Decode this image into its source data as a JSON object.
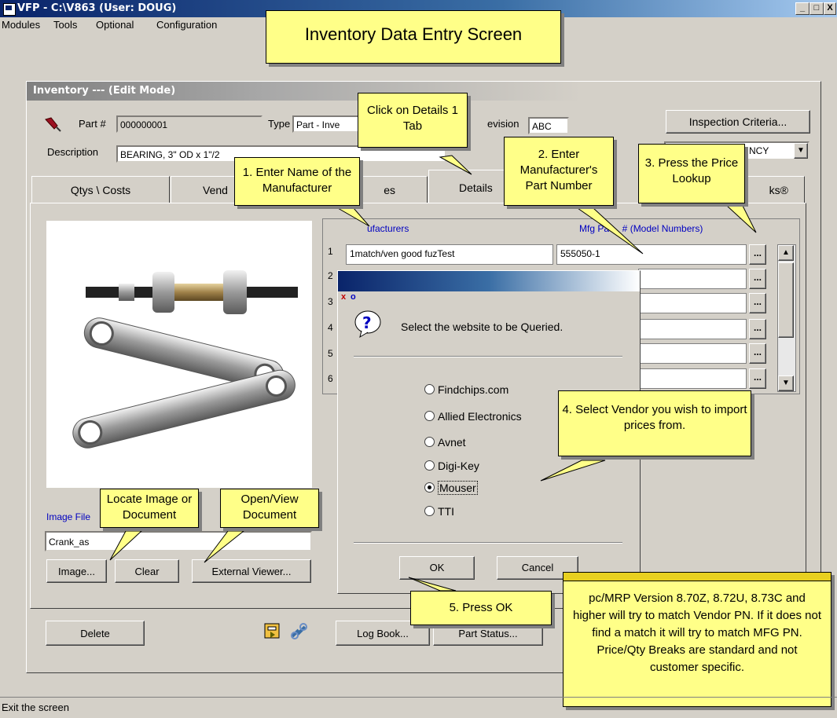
{
  "window": {
    "title": "VFP - C:\\V863  (User: DOUG)",
    "controls": [
      "_",
      "□",
      "X"
    ]
  },
  "menubar": {
    "items": [
      "Modules",
      "Tools",
      "Optional",
      "Configuration"
    ]
  },
  "inventory": {
    "title": "Inventory --- (Edit Mode)",
    "part_label": "Part #",
    "part_value": "000000001",
    "type_label": "Type",
    "type_value": "Part - Inve",
    "revision_label": "evision",
    "revision_value": "ABC",
    "inspection_button": "Inspection Criteria...",
    "description_label": "Description",
    "description_value": "BEARING, 3\" OD x 1\"/2",
    "right_dropdown_value": "NCY",
    "tabs": [
      "Qtys \\ Costs",
      "Vend",
      "es",
      "Details",
      "ks®"
    ],
    "grid": {
      "col_manufacturers": "ufacturers",
      "col_mfg_part": "Mfg Pa     # (Model Numbers)",
      "rows": [
        {
          "num": "1",
          "manufacturer": "1match/ven good fuzTest",
          "part": "555050-1"
        },
        {
          "num": "2",
          "manufacturer": "",
          "part": ""
        },
        {
          "num": "3",
          "manufacturer": "",
          "part": ""
        },
        {
          "num": "4",
          "manufacturer": "",
          "part": ""
        },
        {
          "num": "5",
          "manufacturer": "",
          "part": ""
        },
        {
          "num": "6",
          "manufacturer": "",
          "part": ""
        }
      ],
      "ellipsis": "..."
    },
    "image_file_label": "Image File",
    "image_file_value": "Crank_as",
    "image_button": "Image...",
    "clear_button": "Clear",
    "external_viewer_button": "External Viewer...",
    "delete_button": "Delete",
    "logbook_button": "Log Book...",
    "partstatus_button": "Part Status..."
  },
  "dialog": {
    "prompt": "Select the website to be Queried.",
    "options": [
      "Findchips.com",
      "Allied Electronics",
      "Avnet",
      "Digi-Key",
      "Mouser",
      "TTI"
    ],
    "selected_option": "Mouser",
    "ok_button": "OK",
    "cancel_button": "Cancel",
    "title_icons": [
      "x",
      "o"
    ]
  },
  "callouts": {
    "main_title": "Inventory Data Entry Screen",
    "click_details": "Click on Details 1 Tab",
    "enter_manufacturer": "1. Enter Name of the Manufacturer",
    "enter_part_number": "2. Enter Manufacturer's Part Number",
    "press_price_lookup": "3. Press the Price Lookup",
    "select_vendor": "4. Select Vendor you wish to import prices from.",
    "press_ok": "5. Press OK",
    "locate_image": "Locate Image or Document",
    "open_view": "Open/View Document",
    "version_note": "pc/MRP Version 8.70Z, 8.72U, 8.73C and higher will try to match Vendor PN.  If it does not find a match it will try to match MFG PN.  Price/Qty Breaks are standard and not customer specific."
  },
  "statusbar": {
    "text": "Exit the screen"
  }
}
